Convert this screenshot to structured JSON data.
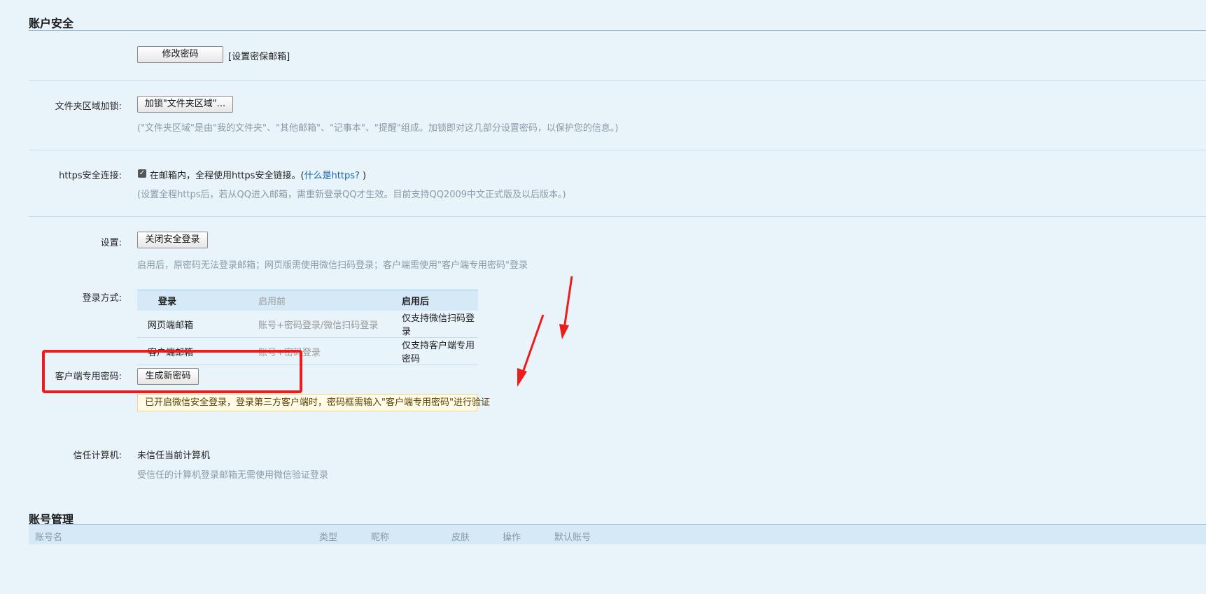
{
  "account_security": {
    "title": "账户安全",
    "change_password_label": "修改密码",
    "set_email_link": "[设置密保邮箱]"
  },
  "folder_lock": {
    "label": "文件夹区域加锁:",
    "button": "加锁\"文件夹区域\"...",
    "hint": "(\"文件夹区域\"是由\"我的文件夹\"、\"其他邮箱\"、\"记事本\"、\"提醒\"组成。加锁即对这几部分设置密码，以保护您的信息。)"
  },
  "https": {
    "label": "https安全连接:",
    "checked": true,
    "text": "在邮箱内，全程使用https安全链接。(",
    "link": "什么是https?",
    "text_end": " )",
    "hint": "(设置全程https后，若从QQ进入邮箱，需重新登录QQ才生效。目前支持QQ2009中文正式版及以后版本。)"
  },
  "settings": {
    "label": "设置:",
    "button": "关闭安全登录",
    "hint": "启用后，原密码无法登录邮箱；网页版需使用微信扫码登录；客户端需使用\"客户端专用密码\"登录"
  },
  "login_method": {
    "label": "登录方式:",
    "headers": [
      "登录",
      "启用前",
      "启用后"
    ],
    "rows": [
      [
        "网页端邮箱",
        "账号+密码登录/微信扫码登录",
        "仅支持微信扫码登录"
      ],
      [
        "客户端邮箱",
        "账号+密码登录",
        "仅支持客户端专用密码"
      ]
    ]
  },
  "client_password": {
    "label": "客户端专用密码:",
    "button": "生成新密码",
    "notice": "已开启微信安全登录，登录第三方客户端时，密码框需输入\"客户端专用密码\"进行验证"
  },
  "trusted_computer": {
    "label": "信任计算机:",
    "status": "未信任当前计算机",
    "hint": "受信任的计算机登录邮箱无需使用微信验证登录"
  },
  "account_management": {
    "title": "账号管理",
    "columns": [
      "账号名",
      "类型",
      "昵称",
      "皮肤",
      "操作",
      "默认账号"
    ]
  },
  "colors": {
    "background": "#e9f3fa",
    "link": "#1566a8",
    "highlight_red": "#ec1c1c",
    "table_header": "#d6e9f6"
  }
}
